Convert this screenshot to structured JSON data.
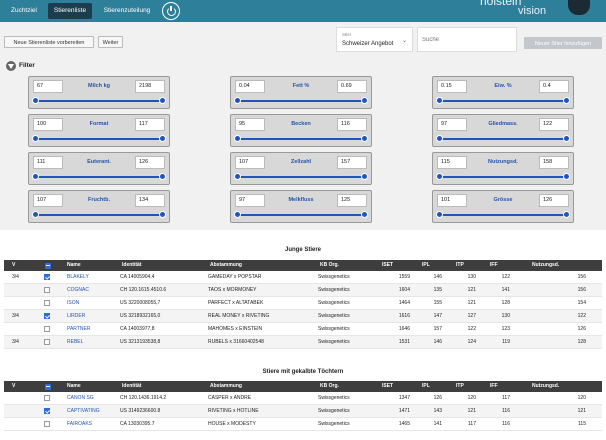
{
  "nav": {
    "zuchtziel": "Zuchtziel",
    "stierenliste": "Stierenliste",
    "zuteilung": "Stierenzuteilung"
  },
  "logo": {
    "line1": "holstein",
    "line2": "vision"
  },
  "toolbar": {
    "prepare": "Neue Stierenliste vorbereiten",
    "weiter": "Weiter",
    "stier_label": "Stier",
    "stier_value": "Schweizer Angebot",
    "search_placeholder": "Suche",
    "add": "Neuer Stier hinzufügen"
  },
  "filter": {
    "title": "Filter",
    "boxes": [
      {
        "name": "Milch kg",
        "min": "67",
        "max": "2198"
      },
      {
        "name": "Fett %",
        "min": "0.04",
        "max": "0.69"
      },
      {
        "name": "Eiw. %",
        "min": "0.15",
        "max": "0.4"
      },
      {
        "name": "Format",
        "min": "100",
        "max": "117"
      },
      {
        "name": "Becken",
        "min": "95",
        "max": "116"
      },
      {
        "name": "Gliedmass.",
        "min": "97",
        "max": "122"
      },
      {
        "name": "Euterant.",
        "min": "111",
        "max": "126"
      },
      {
        "name": "Zellzahl",
        "min": "107",
        "max": "157"
      },
      {
        "name": "Nutzungsd.",
        "min": "115",
        "max": "158"
      },
      {
        "name": "Fruchtb.",
        "min": "107",
        "max": "134"
      },
      {
        "name": "Melkfluss",
        "min": "97",
        "max": "125"
      },
      {
        "name": "Grösse",
        "min": "101",
        "max": "126"
      }
    ]
  },
  "headers": {
    "v": "V",
    "name": "Name",
    "id": "Identität",
    "abst": "Abstammung",
    "kb": "KB Org.",
    "iset": "ISET",
    "ipl": "IPL",
    "itp": "ITP",
    "iff": "IFF",
    "nutz": "Nutzungsd."
  },
  "table1": {
    "title": "Junge Stiere",
    "rows": [
      {
        "v": "3/4",
        "checked": true,
        "name": "BLAKELY",
        "id": "CA 14005904,4",
        "abst": "GAMEDAY x POPSTAR",
        "kb": "Swissgenetics",
        "iset": "1559",
        "ipl": "146",
        "itp": "130",
        "iff": "122",
        "nutz": "156"
      },
      {
        "v": "",
        "checked": false,
        "name": "COGNAC",
        "id": "CH 120.1615.4510.6",
        "abst": "TAOS x MORMONEY",
        "kb": "Swissgenetics",
        "iset": "1604",
        "ipl": "135",
        "itp": "121",
        "iff": "141",
        "nutz": "156"
      },
      {
        "v": "",
        "checked": false,
        "name": "ISON",
        "id": "US 3220008055,7",
        "abst": "PARFECT x ALTATABEK",
        "kb": "Swissgenetics",
        "iset": "1464",
        "ipl": "155",
        "itp": "121",
        "iff": "128",
        "nutz": "154"
      },
      {
        "v": "3/4",
        "checked": true,
        "name": "LIRDER",
        "id": "US 3218932165,0",
        "abst": "REAL MONEY x RIVETING",
        "kb": "Swissgenetics",
        "iset": "1616",
        "ipl": "147",
        "itp": "127",
        "iff": "130",
        "nutz": "122"
      },
      {
        "v": "",
        "checked": false,
        "name": "PARTNER",
        "id": "CA 14003977,8",
        "abst": "MAHOMES x EINSTEIN",
        "kb": "Swissgenetics",
        "iset": "1646",
        "ipl": "157",
        "itp": "122",
        "iff": "123",
        "nutz": "126"
      },
      {
        "v": "3/4",
        "checked": false,
        "name": "REBEL",
        "id": "US 3213193538,8",
        "abst": "RUBELS x 31660402548",
        "kb": "Swissgenetics",
        "iset": "1531",
        "ipl": "146",
        "itp": "124",
        "iff": "119",
        "nutz": "128"
      }
    ]
  },
  "table2": {
    "title": "Stiere mit gekalbte Töchtern",
    "rows": [
      {
        "v": "",
        "checked": false,
        "name": "CANON SG",
        "id": "CH 120.1436.1914.2",
        "abst": "CASPER x ANDRE",
        "kb": "Swissgenetics",
        "iset": "1347",
        "ipl": "126",
        "itp": "120",
        "iff": "117",
        "nutz": "120"
      },
      {
        "v": "",
        "checked": true,
        "name": "CAPTIVATING",
        "id": "US 3149236600.8",
        "abst": "RIVETING x HOTLINE",
        "kb": "Swissgenetics",
        "iset": "1471",
        "ipl": "143",
        "itp": "121",
        "iff": "116",
        "nutz": "121"
      },
      {
        "v": "",
        "checked": false,
        "name": "FAIROAKS",
        "id": "CA 13030395.7",
        "abst": "HOUSE x MODESTY",
        "kb": "Swissgenetics",
        "iset": "1465",
        "ipl": "141",
        "itp": "117",
        "iff": "116",
        "nutz": "115"
      }
    ]
  }
}
